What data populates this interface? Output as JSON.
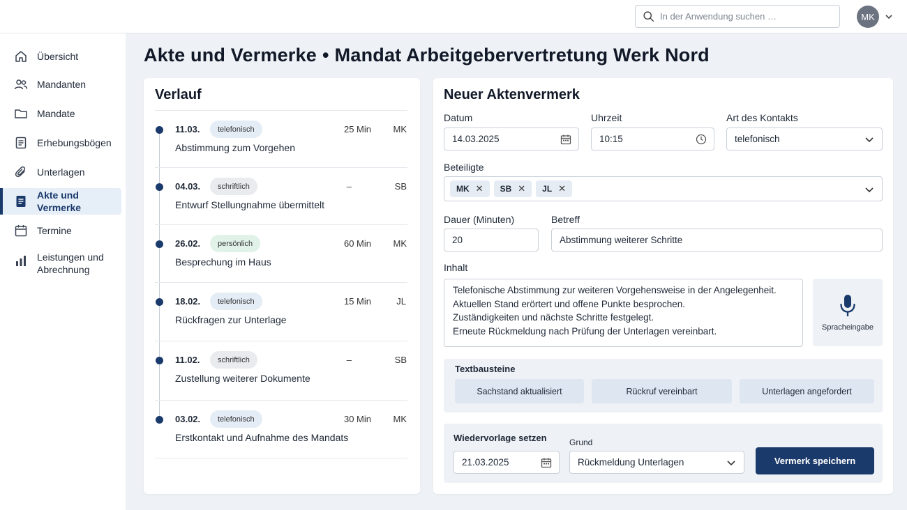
{
  "header": {
    "search_placeholder": "In der Anwendung suchen …",
    "user_initials": "MK"
  },
  "sidebar": {
    "items": [
      {
        "label": "Übersicht",
        "icon": "home-icon"
      },
      {
        "label": "Mandanten",
        "icon": "users-icon"
      },
      {
        "label": "Mandate",
        "icon": "folder-icon"
      },
      {
        "label": "Erhebungsbögen",
        "icon": "form-icon"
      },
      {
        "label": "Unterlagen",
        "icon": "paperclip-icon"
      },
      {
        "label": "Akte und Vermerke",
        "icon": "document-icon",
        "active": true
      },
      {
        "label": "Termine",
        "icon": "calendar-icon"
      },
      {
        "label": "Leistungen und Abrechnung",
        "icon": "bar-chart-icon"
      }
    ]
  },
  "page": {
    "title": "Akte und Vermerke",
    "separator": "•",
    "mandate": "Mandat Arbeitgebervertretung Werk Nord"
  },
  "verlauf": {
    "title": "Verlauf",
    "entries": [
      {
        "date": "11.03.",
        "type": "telefonisch",
        "duration": "25 Min",
        "initials": "MK",
        "text": "Abstimmung zum Vorgehen"
      },
      {
        "date": "04.03.",
        "type": "schriftlich",
        "duration": "–",
        "initials": "SB",
        "text": "Entwurf Stellungnahme übermittelt"
      },
      {
        "date": "26.02.",
        "type": "persönlich",
        "duration": "60 Min",
        "initials": "MK",
        "text": "Besprechung im Haus"
      },
      {
        "date": "18.02.",
        "type": "telefonisch",
        "duration": "15 Min",
        "initials": "JL",
        "text": "Rückfragen zur Unterlage"
      },
      {
        "date": "11.02.",
        "type": "schriftlich",
        "duration": "–",
        "initials": "SB",
        "text": "Zustellung weiterer Dokumente"
      },
      {
        "date": "03.02.",
        "type": "telefonisch",
        "duration": "30 Min",
        "initials": "MK",
        "text": "Erstkontakt und Aufnahme des Mandats"
      }
    ]
  },
  "form": {
    "title": "Neuer Aktenvermerk",
    "datum_label": "Datum",
    "datum_value": "14.03.2025",
    "uhrzeit_label": "Uhrzeit",
    "uhrzeit_value": "10:15",
    "kontakt_label": "Art des Kontakts",
    "kontakt_value": "telefonisch",
    "beteiligte_label": "Beteiligte",
    "beteiligte": [
      "MK",
      "SB",
      "JL"
    ],
    "chip_remove": "✕",
    "dauer_label": "Dauer (Minuten)",
    "dauer_value": "20",
    "betreff_label": "Betreff",
    "betreff_value": "Abstimmung weiterer Schritte",
    "inhalt_label": "Inhalt",
    "inhalt_lines": [
      "Telefonische Abstimmung zur weiteren Vorgehensweise in der Angelegenheit.",
      "Aktuellen Stand erörtert und offene Punkte besprochen.",
      "Zuständigkeiten und nächste Schritte festgelegt.",
      "Erneute Rückmeldung nach Prüfung der Unterlagen vereinbart."
    ],
    "mic_label": "Spracheingabe",
    "textbausteine_label": "Textbausteine",
    "textbausteine": [
      "Sachstand aktualisiert",
      "Rückruf vereinbart",
      "Unterlagen angefordert"
    ],
    "wiedervorlage_label": "Wiedervorlage setzen",
    "wiedervorlage_value": "21.03.2025",
    "grund_label": "Grund",
    "grund_value": "Rückmeldung Unterlagen",
    "save_label": "Vermerk speichern"
  },
  "colors": {
    "accent": "#1a3a6b",
    "badge_telefonisch": "#e4ecf6",
    "badge_schriftlich": "#e9ebee",
    "badge_persoenlich": "#e1f2e9"
  }
}
